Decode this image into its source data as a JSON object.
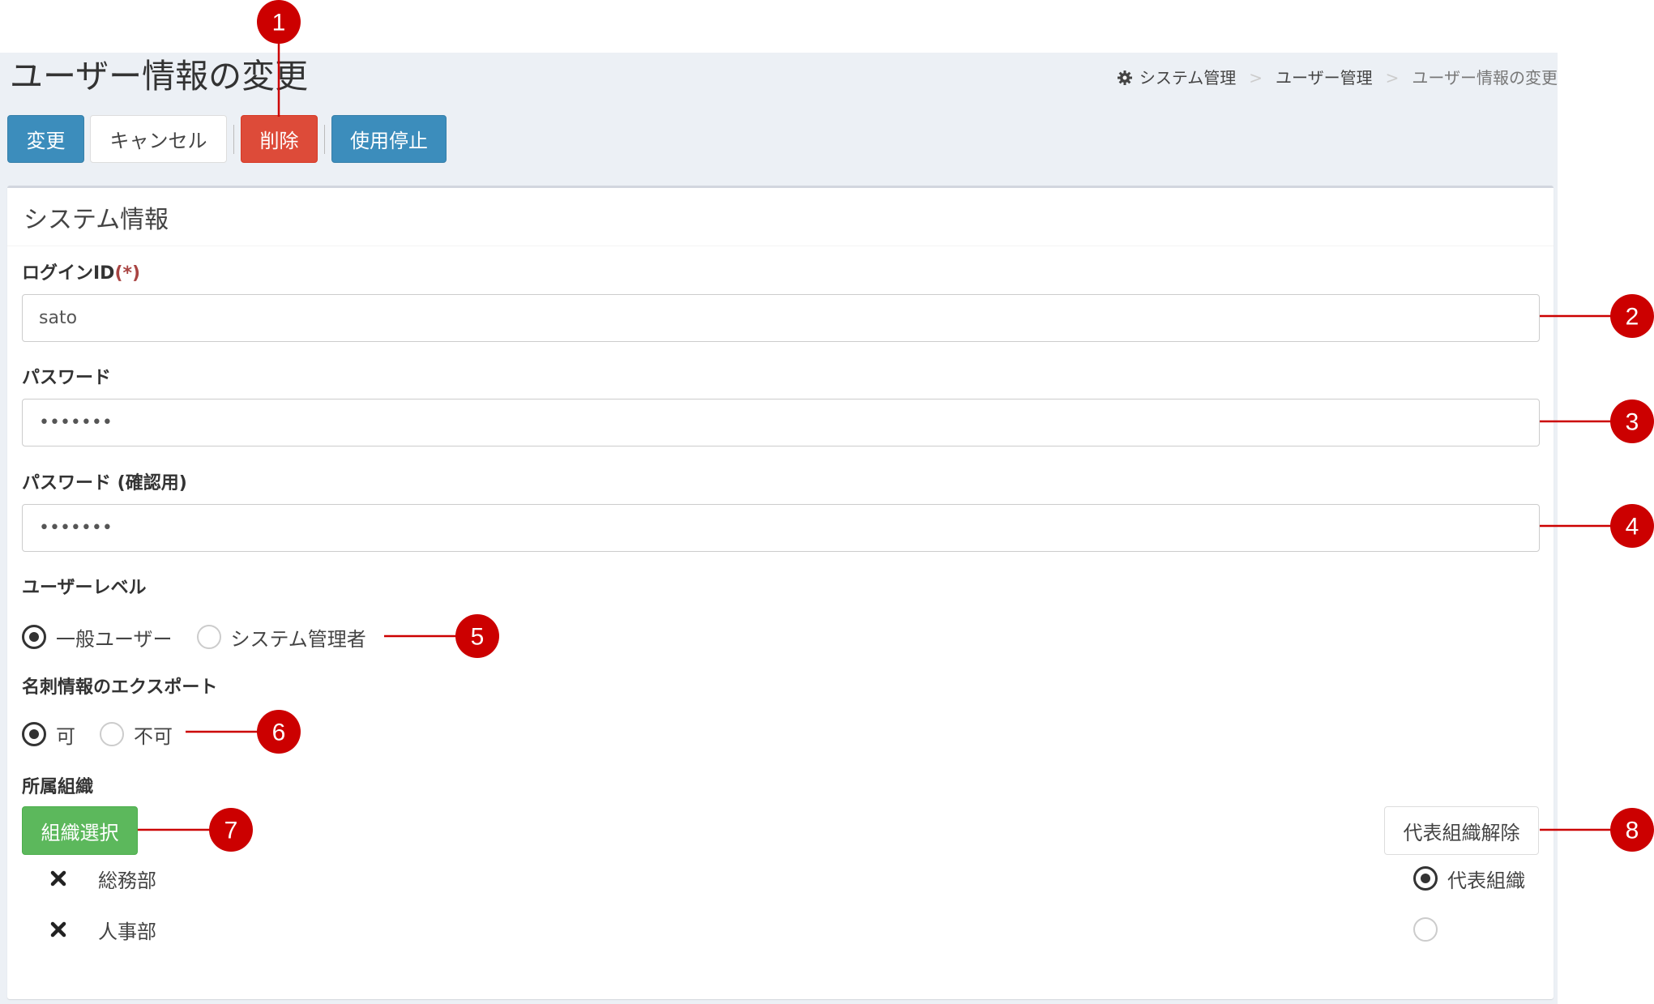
{
  "page": {
    "title": "ユーザー情報の変更"
  },
  "breadcrumb": {
    "items": [
      "システム管理",
      "ユーザー管理",
      "ユーザー情報の変更"
    ]
  },
  "toolbar": {
    "change_label": "変更",
    "cancel_label": "キャンセル",
    "delete_label": "削除",
    "suspend_label": "使用停止"
  },
  "panel": {
    "title": "システム情報"
  },
  "form": {
    "login_id": {
      "label": "ログインID",
      "required_mark": "(*)",
      "value": "sato"
    },
    "password": {
      "label": "パスワード",
      "value": "•••••••"
    },
    "password_confirm": {
      "label": "パスワード (確認用)",
      "value": "•••••••"
    },
    "user_level": {
      "label": "ユーザーレベル",
      "options": [
        {
          "label": "一般ユーザー",
          "checked": true
        },
        {
          "label": "システム管理者",
          "checked": false
        }
      ]
    },
    "card_export": {
      "label": "名刺情報のエクスポート",
      "options": [
        {
          "label": "可",
          "checked": true
        },
        {
          "label": "不可",
          "checked": false
        }
      ]
    },
    "organization": {
      "label": "所属組織",
      "select_button": "組織選択",
      "clear_rep_button": "代表組織解除",
      "rows": [
        {
          "name": "総務部",
          "rep_label": "代表組織",
          "rep_checked": true
        },
        {
          "name": "人事部",
          "rep_label": "",
          "rep_checked": false
        }
      ]
    }
  },
  "annotations": {
    "color": "#cc0000",
    "markers": [
      "1",
      "2",
      "3",
      "4",
      "5",
      "6",
      "7",
      "8"
    ]
  }
}
